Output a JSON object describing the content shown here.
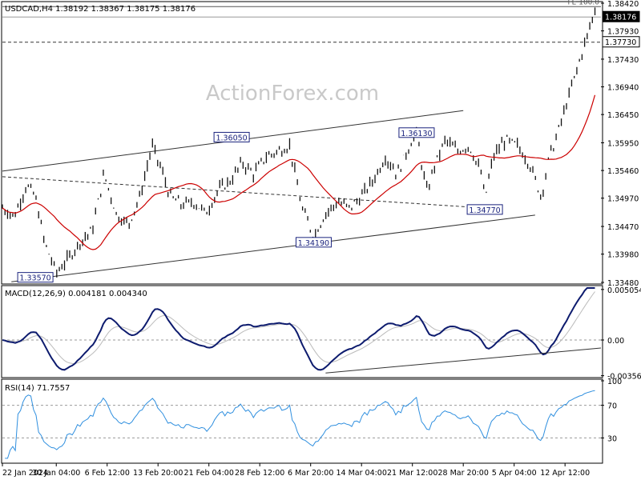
{
  "chart_data": [
    {
      "type": "line",
      "panel": "price",
      "title": "USDCAD,H4  1.38192 1.38367 1.38175 1.38176",
      "watermark": "ActionForex.com",
      "ylim": [
        1.3348,
        1.3842
      ],
      "y_ticks": [
        "1.38420",
        "1.37930",
        "1.37430",
        "1.36940",
        "1.36450",
        "1.35950",
        "1.35460",
        "1.34970",
        "1.34470",
        "1.33980",
        "1.33480"
      ],
      "price_tags": [
        {
          "label": "1.38176",
          "value": 1.38176,
          "dark": true
        },
        {
          "label": "1.37730",
          "value": 1.3773,
          "dark": false
        }
      ],
      "hlines": [
        {
          "value": 1.3836,
          "style": "solid",
          "label": "FE 100.0"
        },
        {
          "value": 1.38176,
          "style": "solid-gray",
          "label": ""
        },
        {
          "value": 1.3773,
          "style": "dashed",
          "label": ""
        }
      ],
      "x_labels": [
        "22 Jan 2024",
        "30 Jan 04:00",
        "6 Feb 12:00",
        "13 Feb 20:00",
        "21 Feb 04:00",
        "28 Feb 12:00",
        "6 Mar 20:00",
        "14 Mar 04:00",
        "21 Mar 12:00",
        "28 Mar 20:00",
        "5 Apr 04:00",
        "12 Apr 12:00"
      ],
      "x_label_frac": [
        0.0,
        0.09,
        0.175,
        0.26,
        0.345,
        0.43,
        0.515,
        0.6,
        0.685,
        0.77,
        0.855,
        0.94
      ],
      "annotations": [
        {
          "label": "1.33570",
          "value": 1.3357,
          "x": 0.055
        },
        {
          "label": "1.36050",
          "value": 1.3605,
          "x": 0.383
        },
        {
          "label": "1.34190",
          "value": 1.3419,
          "x": 0.52
        },
        {
          "label": "1.36130",
          "value": 1.3613,
          "x": 0.692
        },
        {
          "label": "1.34770",
          "value": 1.3477,
          "x": 0.806
        }
      ],
      "trendlines": [
        {
          "from": [
            0.0,
            1.3545
          ],
          "to": [
            0.77,
            1.3652
          ],
          "style": "solid"
        },
        {
          "from": [
            0.015,
            1.3349
          ],
          "to": [
            0.89,
            1.3467
          ],
          "style": "solid"
        },
        {
          "from": [
            0.0,
            1.3535
          ],
          "to": [
            0.8,
            1.348
          ],
          "style": "dashed"
        }
      ],
      "series": [
        {
          "name": "",
          "color": "#111111",
          "x": [
            0.0,
            0.02,
            0.04,
            0.055,
            0.07,
            0.09,
            0.11,
            0.13,
            0.15,
            0.17,
            0.19,
            0.21,
            0.23,
            0.25,
            0.265,
            0.28,
            0.3,
            0.32,
            0.34,
            0.36,
            0.383,
            0.4,
            0.42,
            0.44,
            0.46,
            0.48,
            0.5,
            0.52,
            0.54,
            0.56,
            0.58,
            0.6,
            0.62,
            0.64,
            0.66,
            0.68,
            0.692,
            0.7,
            0.71,
            0.72,
            0.74,
            0.76,
            0.78,
            0.8,
            0.806,
            0.82,
            0.84,
            0.86,
            0.88,
            0.9,
            0.92,
            0.94,
            0.96,
            0.98,
            1.0
          ],
          "values": [
            1.348,
            1.3465,
            1.352,
            1.35,
            1.342,
            1.3365,
            1.339,
            1.342,
            1.344,
            1.354,
            1.347,
            1.345,
            1.35,
            1.359,
            1.355,
            1.35,
            1.3485,
            1.349,
            1.347,
            1.351,
            1.353,
            1.356,
            1.354,
            1.357,
            1.358,
            1.359,
            1.348,
            1.343,
            1.347,
            1.349,
            1.348,
            1.35,
            1.353,
            1.357,
            1.354,
            1.359,
            1.3613,
            1.356,
            1.3505,
            1.355,
            1.36,
            1.358,
            1.359,
            1.354,
            1.3495,
            1.357,
            1.36,
            1.359,
            1.356,
            1.35,
            1.36,
            1.364,
            1.36,
            1.356,
            1.358
          ]
        }
      ]
    },
    {
      "type": "line",
      "panel": "macd",
      "title": "MACD(12,26,9) 0.004181 0.004340",
      "y_ticks": [
        "0.005054",
        "0.00",
        "-0.003569"
      ],
      "ylim": [
        -0.0036,
        0.0052
      ]
    },
    {
      "type": "line",
      "panel": "rsi",
      "title": "RSI(14) 71.7557",
      "y_ticks": [
        "100",
        "70",
        "30",
        "0"
      ],
      "ylim": [
        0,
        100
      ]
    }
  ]
}
